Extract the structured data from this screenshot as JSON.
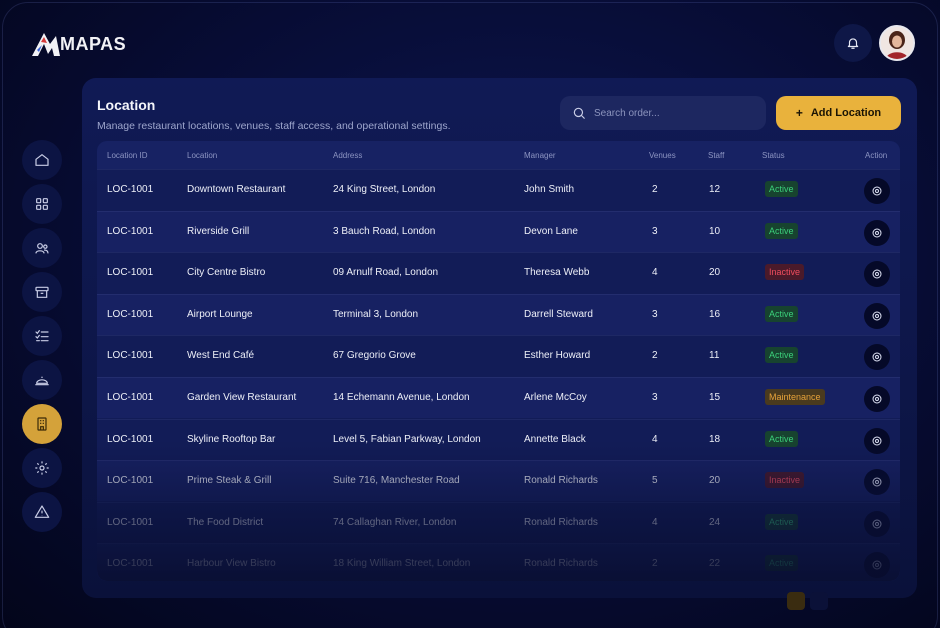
{
  "app": {
    "logo_text": "MAPAS"
  },
  "page": {
    "title": "Location",
    "subtitle": "Manage restaurant locations, venues, staff access, and operational settings."
  },
  "search": {
    "placeholder": "Search order..."
  },
  "add_button": {
    "label": "Add Location",
    "icon": "plus-icon"
  },
  "sidebar": {
    "items": [
      {
        "name": "home",
        "icon": "home-icon",
        "active": false
      },
      {
        "name": "dashboard",
        "icon": "grid-icon",
        "active": false
      },
      {
        "name": "users",
        "icon": "users-icon",
        "active": false
      },
      {
        "name": "inventory",
        "icon": "box-icon",
        "active": false
      },
      {
        "name": "tasks",
        "icon": "checklist-icon",
        "active": false
      },
      {
        "name": "menu",
        "icon": "cloche-icon",
        "active": false
      },
      {
        "name": "location",
        "icon": "building-icon",
        "active": true
      },
      {
        "name": "settings",
        "icon": "gear-icon",
        "active": false
      },
      {
        "name": "alerts",
        "icon": "warning-icon",
        "active": false
      }
    ]
  },
  "table": {
    "columns": [
      "Location ID",
      "Location",
      "Address",
      "Manager",
      "Venues",
      "Staff",
      "Status",
      "Action"
    ],
    "rows": [
      {
        "id": "LOC-1001",
        "location": "Downtown Restaurant",
        "address": "24 King Street, London",
        "manager": "John Smith",
        "venues": "2",
        "staff": "12",
        "status": "Active",
        "status_kind": "active"
      },
      {
        "id": "LOC-1001",
        "location": "Riverside Grill",
        "address": "3 Bauch Road, London",
        "manager": "Devon Lane",
        "venues": "3",
        "staff": "10",
        "status": "Active",
        "status_kind": "active"
      },
      {
        "id": "LOC-1001",
        "location": "City Centre Bistro",
        "address": "09 Arnulf Road, London",
        "manager": "Theresa Webb",
        "venues": "4",
        "staff": "20",
        "status": "Inactive",
        "status_kind": "inactive"
      },
      {
        "id": "LOC-1001",
        "location": "Airport Lounge",
        "address": "Terminal 3, London",
        "manager": "Darrell Steward",
        "venues": "3",
        "staff": "16",
        "status": "Active",
        "status_kind": "active"
      },
      {
        "id": "LOC-1001",
        "location": "West End Café",
        "address": "67 Gregorio Grove",
        "manager": "Esther Howard",
        "venues": "2",
        "staff": "11",
        "status": "Active",
        "status_kind": "active"
      },
      {
        "id": "LOC-1001",
        "location": "Garden View Restaurant",
        "address": "14 Echemann Avenue, London",
        "manager": "Arlene McCoy",
        "venues": "3",
        "staff": "15",
        "status": "Maintenance",
        "status_kind": "maint"
      },
      {
        "id": "LOC-1001",
        "location": "Skyline Rooftop Bar",
        "address": "Level 5, Fabian Parkway, London",
        "manager": "Annette Black",
        "venues": "4",
        "staff": "18",
        "status": "Active",
        "status_kind": "active"
      },
      {
        "id": "LOC-1001",
        "location": "Prime Steak & Grill",
        "address": "Suite 716, Manchester Road",
        "manager": "Ronald Richards",
        "venues": "5",
        "staff": "20",
        "status": "Inactive",
        "status_kind": "inactive"
      },
      {
        "id": "LOC-1001",
        "location": "The Food District",
        "address": "74 Callaghan River, London",
        "manager": "Ronald Richards",
        "venues": "4",
        "staff": "24",
        "status": "Active",
        "status_kind": "active"
      },
      {
        "id": "LOC-1001",
        "location": "Harbour View Bistro",
        "address": "18 King William Street, London",
        "manager": "Ronald Richards",
        "venues": "2",
        "staff": "22",
        "status": "Active",
        "status_kind": "active"
      }
    ]
  },
  "colors": {
    "accent": "#e9b23c",
    "active_text": "#3bd07b",
    "inactive_text": "#ef4d5e",
    "maintenance_text": "#e6a23a",
    "panel": "#101a55"
  }
}
